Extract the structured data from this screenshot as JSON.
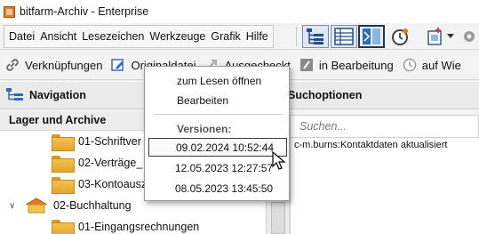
{
  "window": {
    "title": "bitfarm-Archiv - Enterprise",
    "app_icon": "bitfarm-app-icon"
  },
  "menu": {
    "items": [
      {
        "label": "Datei"
      },
      {
        "label": "Ansicht"
      },
      {
        "label": "Lesezeichen"
      },
      {
        "label": "Werkzeuge"
      },
      {
        "label": "Grafik"
      },
      {
        "label": "Hilfe"
      }
    ]
  },
  "toolbar": {
    "buttons": [
      {
        "icon": "tree-view-icon"
      },
      {
        "icon": "list-view-icon"
      },
      {
        "icon": "split-view-icon"
      },
      {
        "icon": "history-clock-icon"
      },
      {
        "icon": "new-document-icon"
      },
      {
        "icon": "dropdown-arrow-icon"
      }
    ]
  },
  "doc_toolbar": {
    "items": [
      {
        "label": "Verknüpfungen",
        "icon": "link-icon"
      },
      {
        "label": "Originaldatei",
        "icon": "edit-original-icon"
      },
      {
        "label": "Ausgecheckt",
        "icon": "checkout-icon"
      },
      {
        "label": "in Bearbeitung",
        "icon": "in-progress-icon"
      },
      {
        "label": "auf Wie",
        "icon": "resubmission-clock-icon"
      }
    ]
  },
  "navigation": {
    "title": "Navigation"
  },
  "search_options": {
    "title": "Suchoptionen",
    "placeholder": "Suchen..."
  },
  "tree": {
    "header": "Lager und Archive",
    "rows": [
      {
        "label": "01-Schriftver",
        "level": 2
      },
      {
        "label": "02-Verträge_",
        "level": 2
      },
      {
        "label": "03-Kontoausz",
        "level": 2
      },
      {
        "label": "02-Buchhaltung",
        "level": 1,
        "expanded": true
      },
      {
        "label": "01-Eingangsrechnungen",
        "level": 2
      }
    ]
  },
  "results": {
    "first_row": "c-m.burns:Kontaktdaten aktualisiert"
  },
  "popup": {
    "open_readonly": "zum Lesen öffnen",
    "edit": "Bearbeiten",
    "versions_header": "Versionen:",
    "versions": [
      {
        "label": "09.02.2024 10:52:44",
        "selected": true
      },
      {
        "label": "12.05.2023 12:27:57",
        "selected": false
      },
      {
        "label": "08.05.2023 13:45:50",
        "selected": false
      }
    ]
  }
}
